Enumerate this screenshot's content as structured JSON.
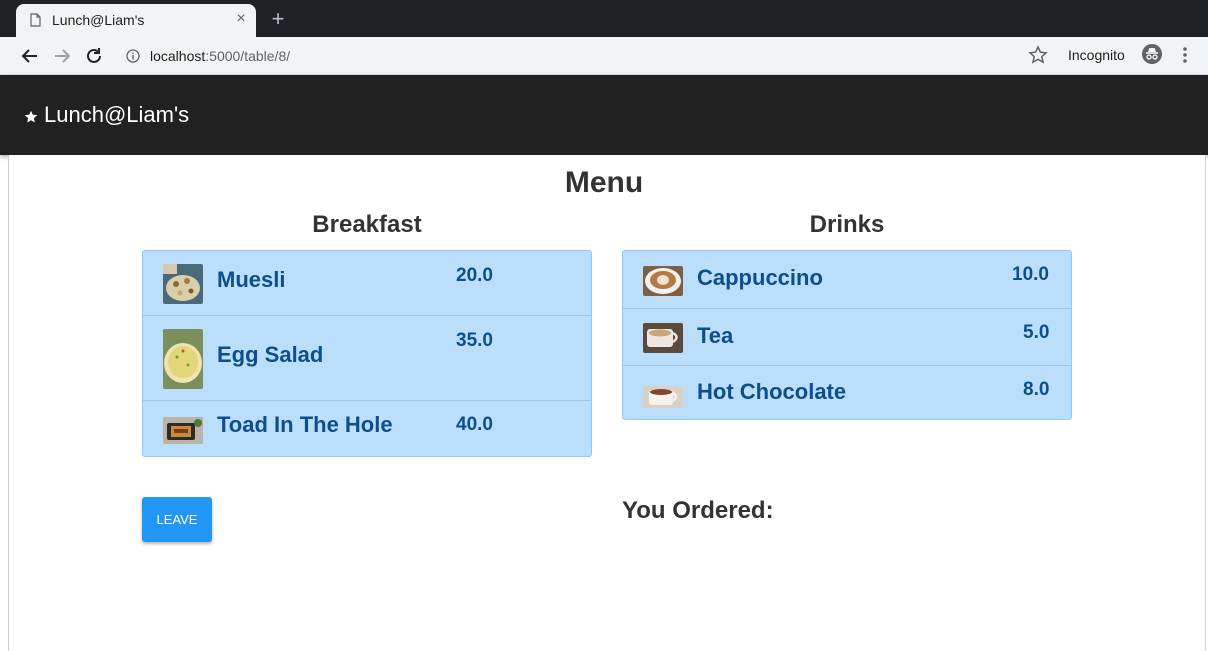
{
  "browser": {
    "tab_title": "Lunch@Liam's",
    "tab_close": "×",
    "new_tab": "+",
    "url_host": "localhost",
    "url_rest": ":5000/table/8/",
    "incognito_label": "Incognito"
  },
  "app": {
    "title": "Lunch@Liam's"
  },
  "menu": {
    "heading": "Menu",
    "breakfast": {
      "title": "Breakfast",
      "items": [
        {
          "name": "Muesli",
          "price": "20.0"
        },
        {
          "name": "Egg Salad",
          "price": "35.0"
        },
        {
          "name": "Toad In The Hole",
          "price": "40.0"
        }
      ]
    },
    "drinks": {
      "title": "Drinks",
      "items": [
        {
          "name": "Cappuccino",
          "price": "10.0"
        },
        {
          "name": "Tea",
          "price": "5.0"
        },
        {
          "name": "Hot Chocolate",
          "price": "8.0"
        }
      ]
    }
  },
  "actions": {
    "leave_label": "LEAVE"
  },
  "order": {
    "title": "You Ordered:"
  },
  "colors": {
    "appbar": "#212121",
    "card_bg": "#bbdefb",
    "item_text": "#0d4f8b",
    "button": "#2196f3"
  }
}
